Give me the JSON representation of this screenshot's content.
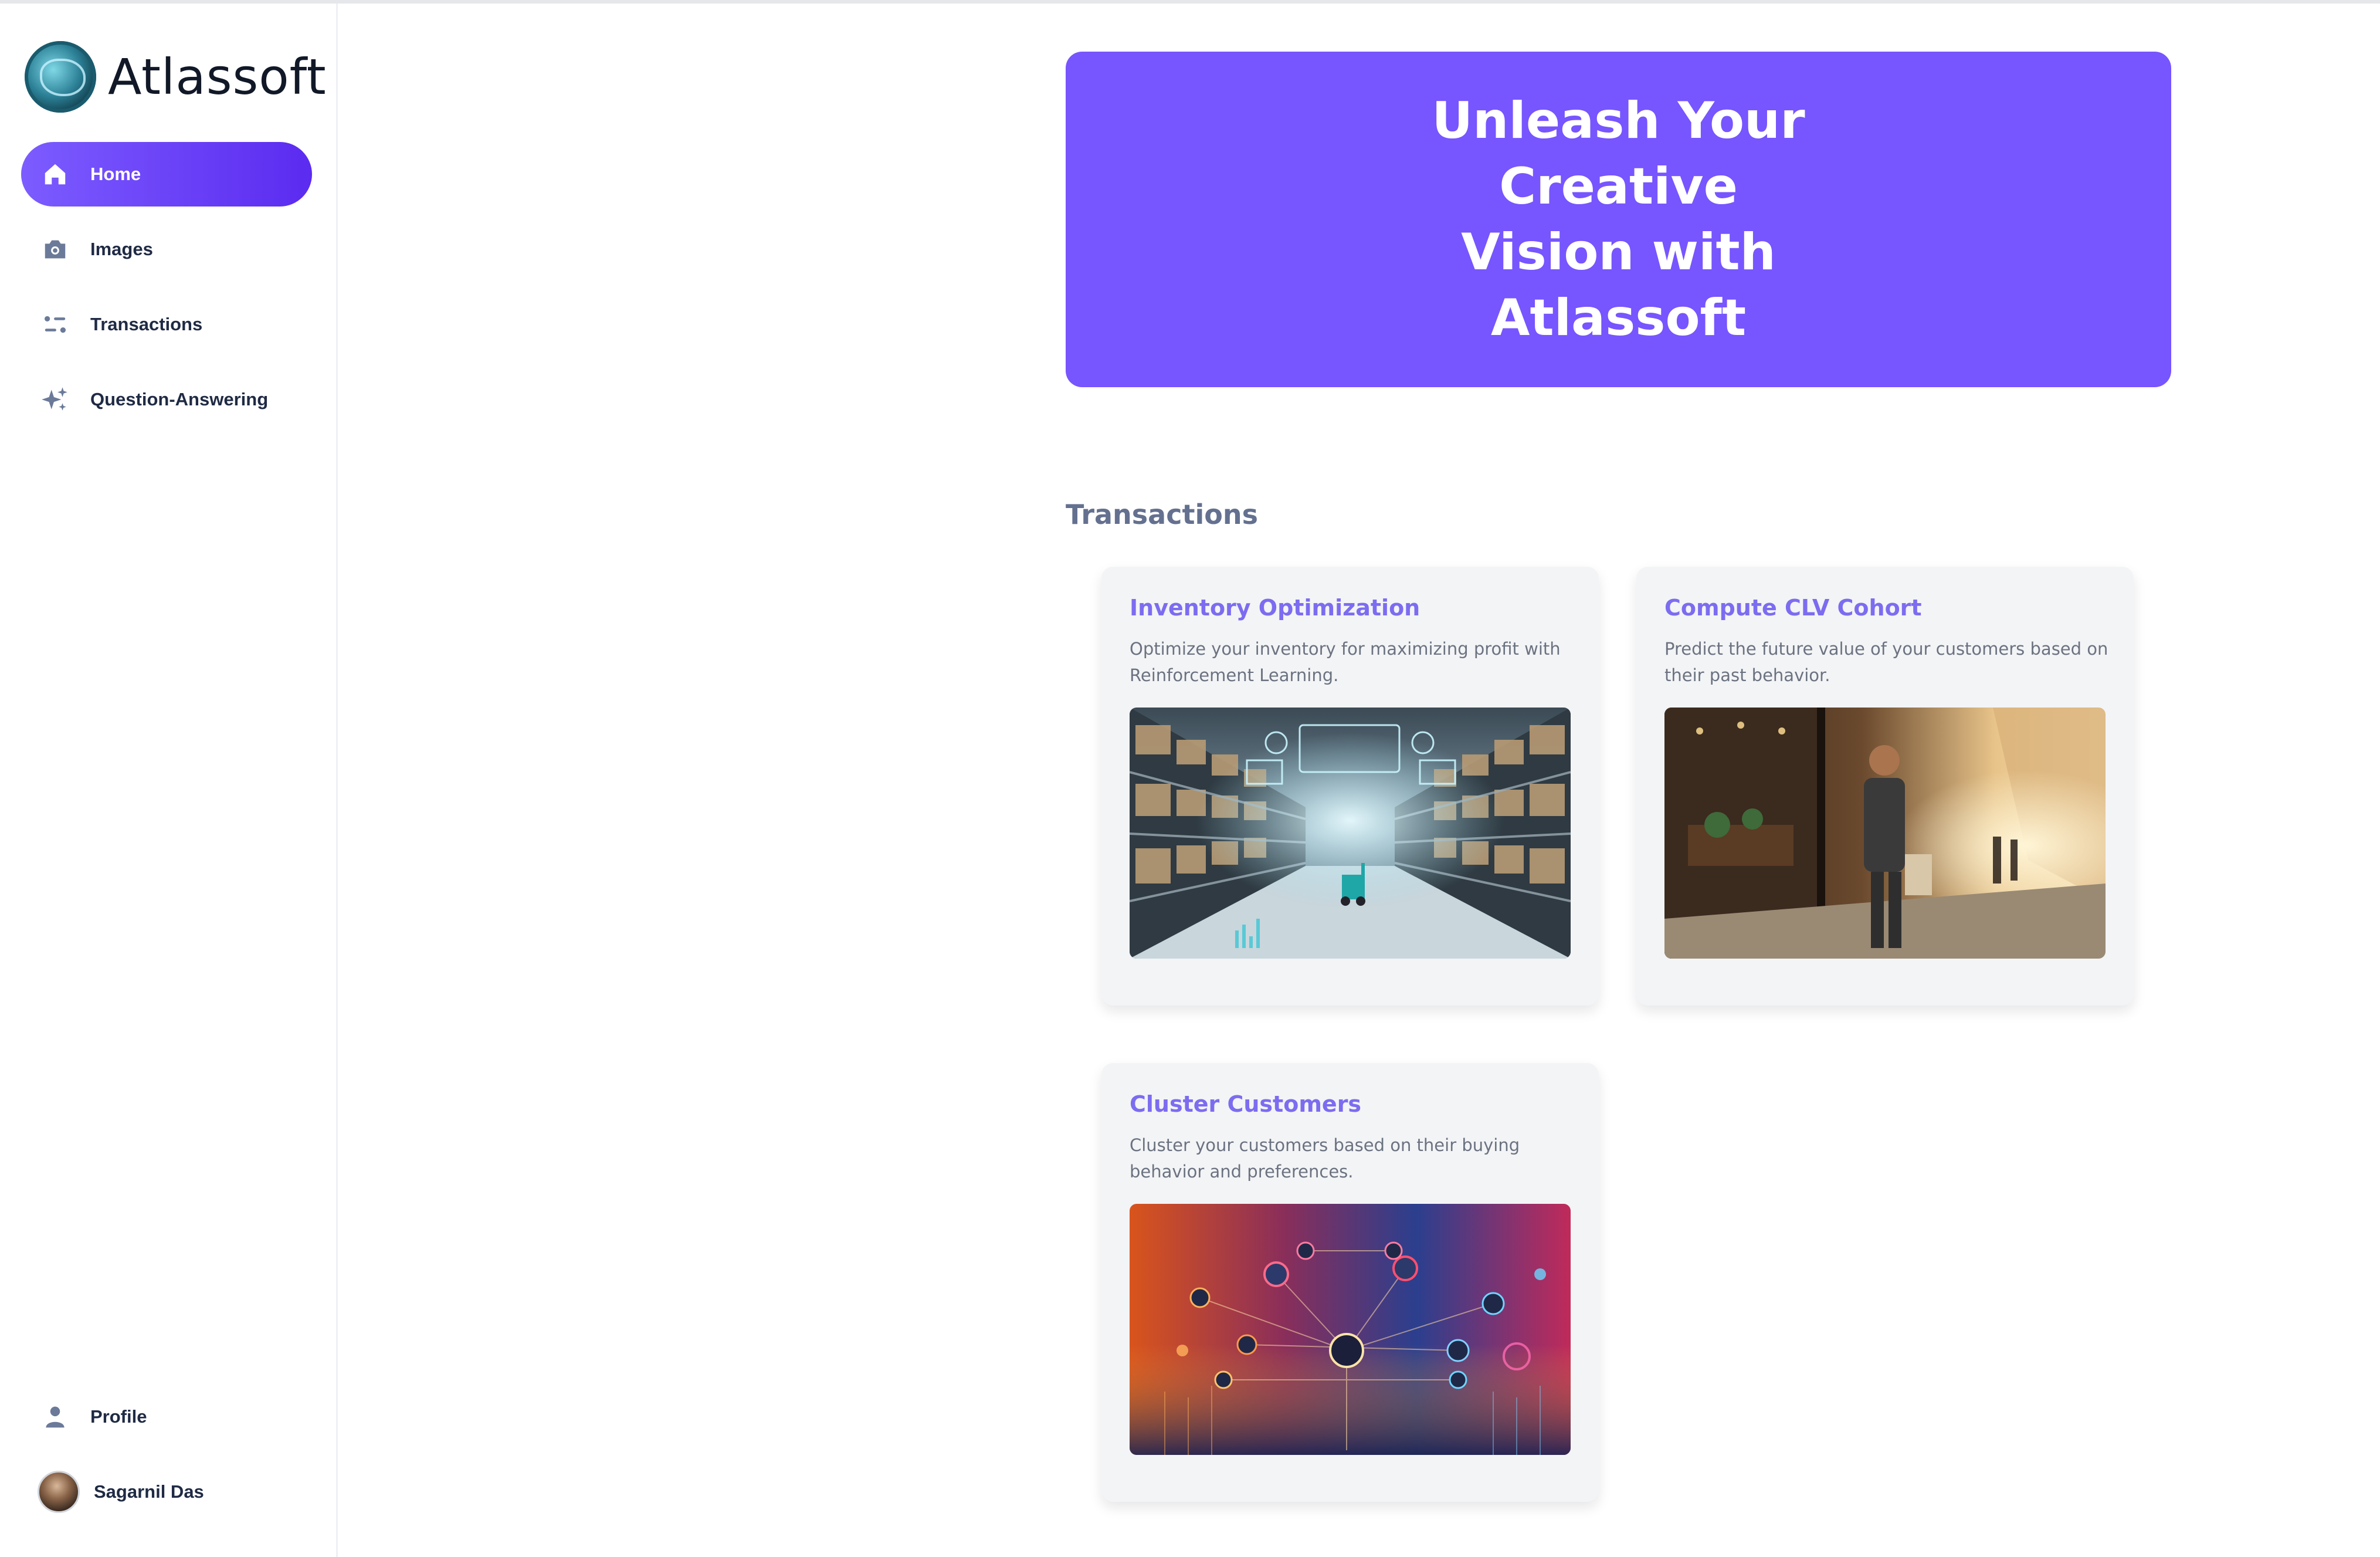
{
  "brand": {
    "name": "Atlassoft"
  },
  "sidebar": {
    "items": [
      {
        "label": "Home",
        "icon": "home-icon",
        "active": true
      },
      {
        "label": "Images",
        "icon": "camera-icon",
        "active": false
      },
      {
        "label": "Transactions",
        "icon": "list-icon",
        "active": false
      },
      {
        "label": "Question-Answering",
        "icon": "sparkles-icon",
        "active": false
      }
    ],
    "profile_label": "Profile",
    "user_name": "Sagarnil Das"
  },
  "hero": {
    "title_line1": "Unleash Your Creative",
    "title_line2": "Vision with Atlassoft"
  },
  "transactions": {
    "title": "Transactions",
    "cards": [
      {
        "title": "Inventory Optimization",
        "description": "Optimize your inventory for maximizing profit with Reinforcement Learning."
      },
      {
        "title": "Compute CLV Cohort",
        "description": "Predict the future value of your customers based on their past behavior."
      },
      {
        "title": "Cluster Customers",
        "description": "Cluster your customers based on their buying behavior and preferences."
      }
    ]
  },
  "colors": {
    "accent": "#7755ff",
    "card_title": "#7c6cf0",
    "section_title": "#64708f"
  }
}
